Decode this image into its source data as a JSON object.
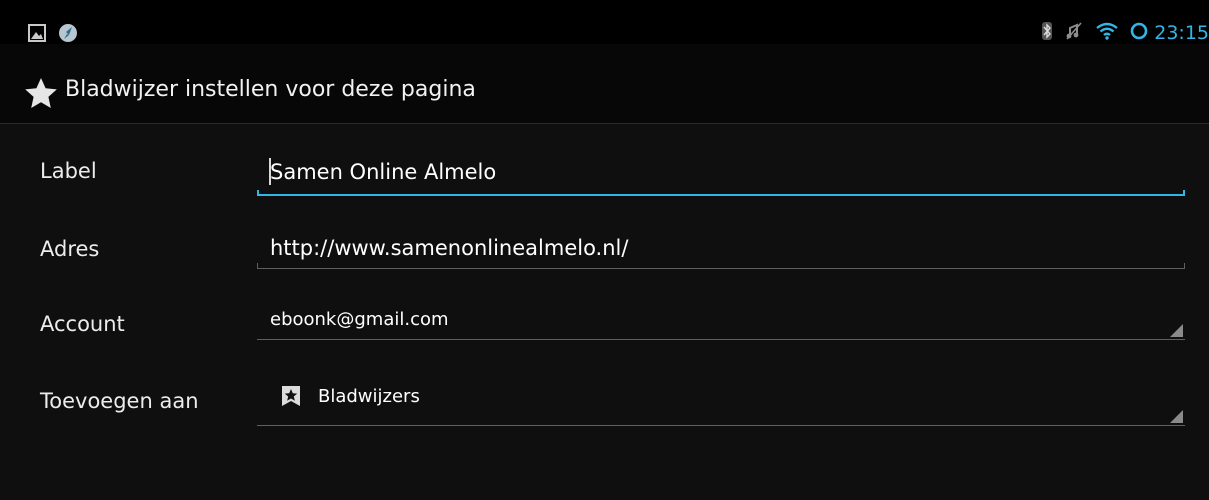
{
  "status_bar": {
    "time": "23:15",
    "left_icons": [
      "gallery-icon",
      "browser-icon"
    ],
    "right_icons": [
      "bluetooth-icon",
      "mute-icon",
      "wifi-icon",
      "sync-icon"
    ]
  },
  "title_bar": {
    "icon": "star-icon",
    "title": "Bladwijzer instellen voor deze pagina"
  },
  "form": {
    "label_field": {
      "label": "Label",
      "value": "Samen Online Almelo"
    },
    "address_field": {
      "label": "Adres",
      "value": "http://www.samenonlinealmelo.nl/"
    },
    "account_field": {
      "label": "Account",
      "value": "eboonk@gmail.com"
    },
    "folder_field": {
      "label": "Toevoegen aan",
      "icon": "bookmark-star-icon",
      "value": "Bladwijzers"
    }
  },
  "colors": {
    "accent": "#33b5e5",
    "background": "#0f0f10",
    "status_bar": "#000000"
  }
}
